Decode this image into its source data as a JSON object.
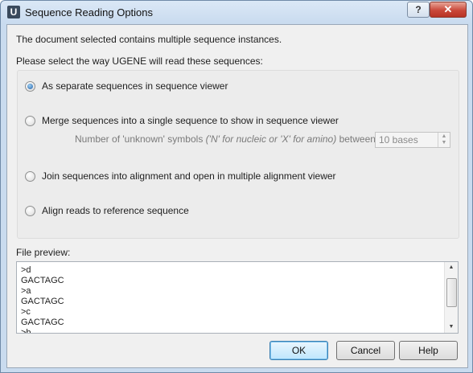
{
  "window": {
    "title": "Sequence Reading Options",
    "icon_letter": "U",
    "help_label": "?",
    "close_label": "✕"
  },
  "intro_text": "The document selected contains multiple sequence instances.",
  "select_text": "Please select the way UGENE will read these sequences:",
  "options": [
    {
      "label": "As separate sequences in sequence viewer",
      "checked": true
    },
    {
      "label": "Merge sequences into a single sequence to show in sequence viewer",
      "checked": false
    },
    {
      "label": "Join sequences into alignment and open in multiple alignment viewer",
      "checked": false
    },
    {
      "label": "Align reads to reference sequence",
      "checked": false
    }
  ],
  "merge": {
    "prefix": "Number of 'unknown' symbols",
    "hint": "('N' for nucleic or 'X' for amino)",
    "suffix": "between parts:",
    "value": "10 bases"
  },
  "preview": {
    "label": "File preview:",
    "lines": [
      ">d",
      "GACTAGC",
      ">a",
      "GACTAGC",
      ">c",
      "GACTAGC",
      ">b"
    ]
  },
  "buttons": {
    "ok": "OK",
    "cancel": "Cancel",
    "help": "Help"
  }
}
